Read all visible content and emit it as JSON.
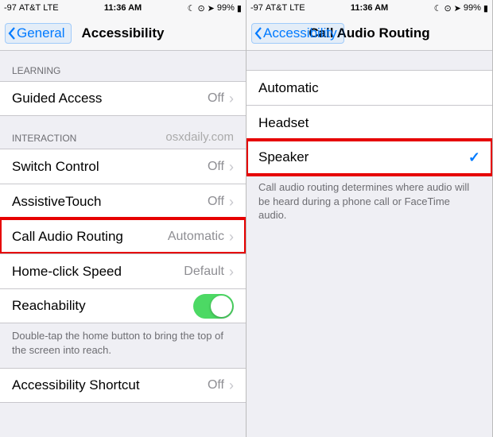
{
  "status": {
    "signal": "-97",
    "carrier": "AT&T",
    "network": "LTE",
    "time": "11:36 AM",
    "battery_pct": "99%"
  },
  "left": {
    "back_label": "General",
    "title": "Accessibility",
    "sections": {
      "learning": {
        "header": "LEARNING",
        "guided_access": {
          "label": "Guided Access",
          "value": "Off"
        }
      },
      "interaction": {
        "header": "INTERACTION",
        "watermark": "osxdaily.com",
        "switch_control": {
          "label": "Switch Control",
          "value": "Off"
        },
        "assistive_touch": {
          "label": "AssistiveTouch",
          "value": "Off"
        },
        "call_audio_routing": {
          "label": "Call Audio Routing",
          "value": "Automatic"
        },
        "home_click_speed": {
          "label": "Home-click Speed",
          "value": "Default"
        },
        "reachability": {
          "label": "Reachability",
          "on": true
        },
        "reach_note": "Double-tap the home button to bring the top of the screen into reach."
      },
      "shortcut": {
        "label": "Accessibility Shortcut",
        "value": "Off"
      }
    }
  },
  "right": {
    "back_label": "Accessibility",
    "title": "Call Audio Routing",
    "options": {
      "automatic": {
        "label": "Automatic",
        "selected": false
      },
      "headset": {
        "label": "Headset",
        "selected": false
      },
      "speaker": {
        "label": "Speaker",
        "selected": true
      }
    },
    "note": "Call audio routing determines where audio will be heard during a phone call or FaceTime audio."
  }
}
